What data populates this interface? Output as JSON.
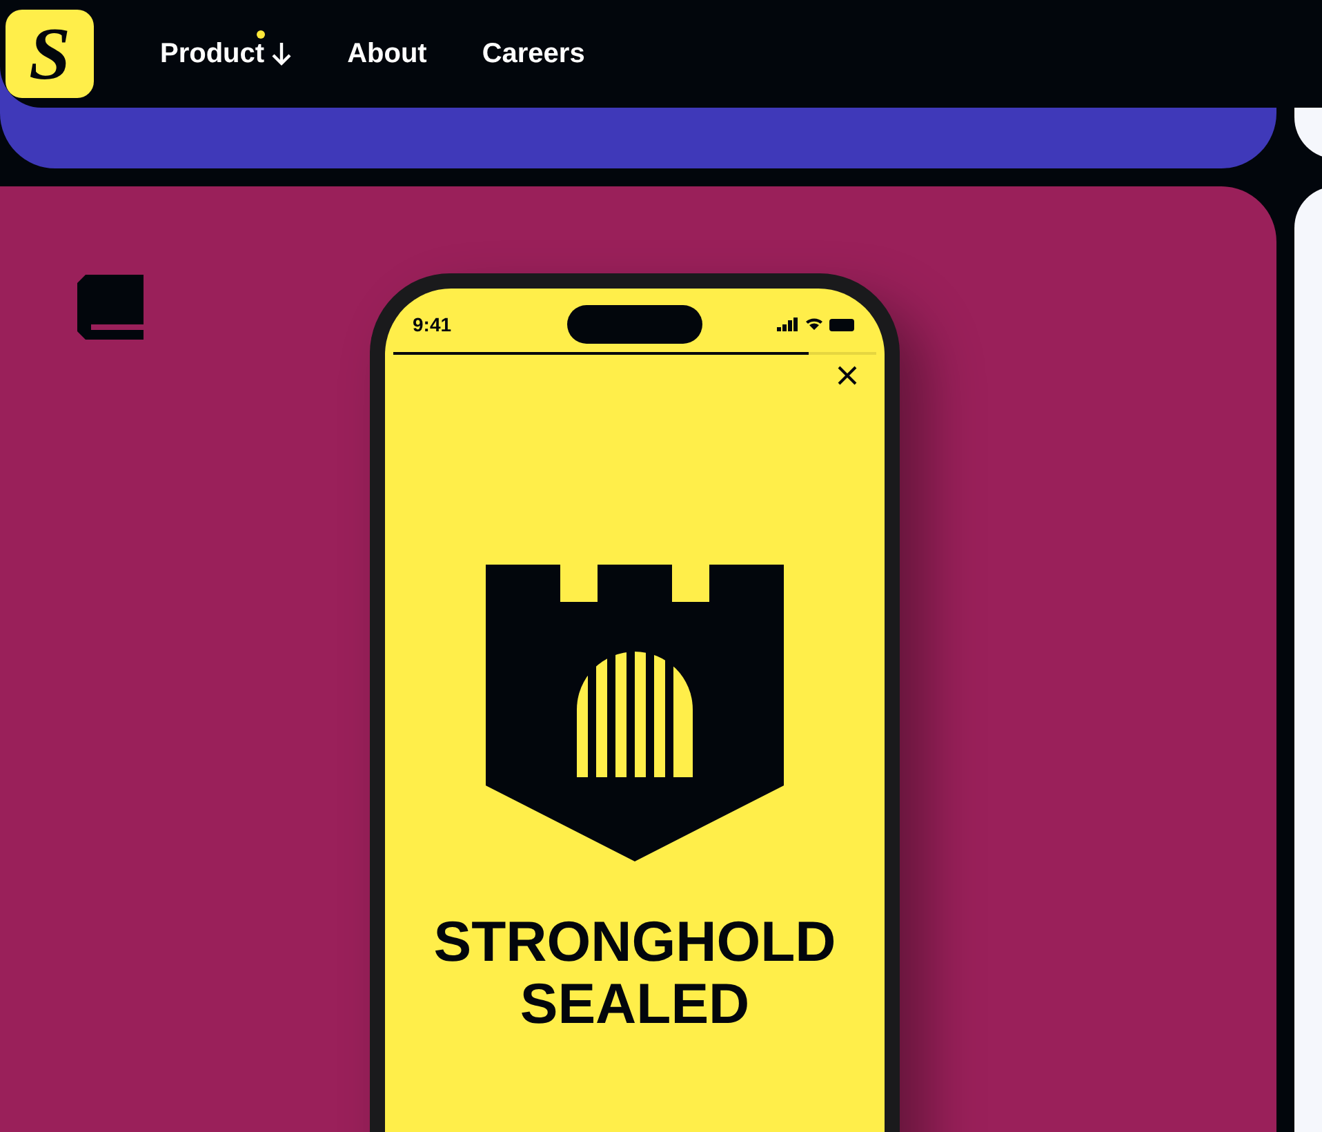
{
  "logo": {
    "text": "S"
  },
  "nav": [
    {
      "label": "Product",
      "has_dot": true,
      "has_dropdown": true
    },
    {
      "label": "About",
      "has_dot": false,
      "has_dropdown": false
    },
    {
      "label": "Careers",
      "has_dot": false,
      "has_dropdown": false
    }
  ],
  "phone": {
    "time": "9:41",
    "progress": {
      "level": 0.86
    },
    "title": "STRONGHOLD SEALED"
  }
}
